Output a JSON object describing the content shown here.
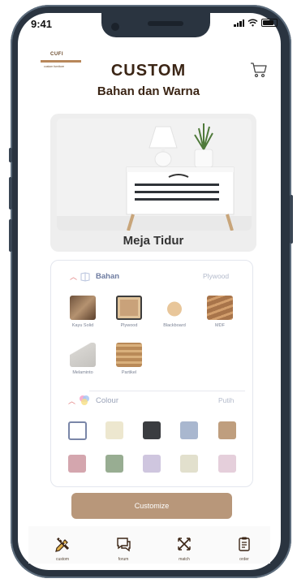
{
  "status": {
    "time": "9:41"
  },
  "brand": {
    "logo_text": "CUFI",
    "logo_sub": "custom furniture"
  },
  "header": {
    "title": "CUSTOM",
    "subtitle": "Bahan dan Warna"
  },
  "product": {
    "name": "Meja Tidur"
  },
  "bahan": {
    "title": "Bahan",
    "selected": "Plywood",
    "options": [
      {
        "label": "Kayu Solid",
        "color": "#8c6a4e"
      },
      {
        "label": "Plywood",
        "color": "#c9a27a"
      },
      {
        "label": "Blackboard",
        "color": "#e8c69a"
      },
      {
        "label": "MDF",
        "color": "#a8744a"
      },
      {
        "label": "Melaminto",
        "color": "#d6d4d0"
      },
      {
        "label": "Partikel",
        "color": "#b98a58"
      }
    ]
  },
  "colour": {
    "title": "Colour",
    "selected": "Putih",
    "swatches": [
      "#ffffff",
      "#ede7cf",
      "#3a3c40",
      "#a9b7cf",
      "#bf9e7e",
      "#d4a6ae",
      "#98ad92",
      "#cfc6df",
      "#e2e0cd",
      "#e5cfdb"
    ]
  },
  "actions": {
    "customize_label": "Customize"
  },
  "tabs": [
    {
      "label": "custom",
      "icon": "pencil-ruler-icon"
    },
    {
      "label": "forum",
      "icon": "chat-icon"
    },
    {
      "label": "match",
      "icon": "cross-arrows-icon"
    },
    {
      "label": "order",
      "icon": "clipboard-icon"
    }
  ],
  "colors": {
    "accent": "#b8977a",
    "title": "#3b2515",
    "label": "#6d7ba0"
  }
}
